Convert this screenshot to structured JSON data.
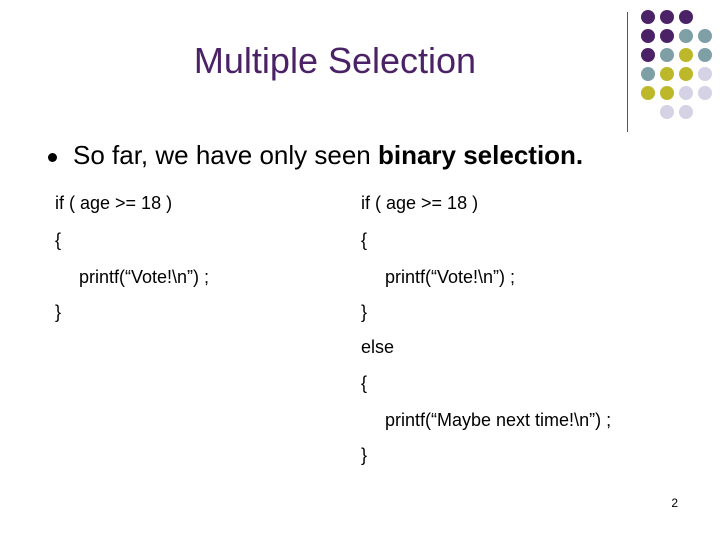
{
  "slide": {
    "title": "Multiple Selection",
    "bullet": {
      "text_before": "So far, we have only seen ",
      "text_bold": "binary selection.",
      "text_after": ""
    },
    "left_code": [
      "if ( age >= 18 )",
      "{",
      "printf(“Vote!\\n”) ;",
      "}"
    ],
    "right_code": [
      "if ( age >= 18 )",
      "{",
      "printf(“Vote!\\n”) ;",
      "}",
      "else",
      "{",
      "printf(“Maybe next time!\\n”) ;",
      "}"
    ],
    "page_number": "2"
  },
  "theme": {
    "title_color": "#4b2266",
    "purple": "#4b2266",
    "teal": "#7f9fa6",
    "olive": "#bcb82a",
    "lavender": "#d4d2e4"
  },
  "decoration": {
    "dot_grid": [
      [
        "purple",
        "purple",
        "purple",
        ""
      ],
      [
        "purple",
        "purple",
        "teal",
        "teal"
      ],
      [
        "purple",
        "teal",
        "olive",
        "teal"
      ],
      [
        "teal",
        "olive",
        "olive",
        "lavender"
      ],
      [
        "olive",
        "olive",
        "lavender",
        "lavender"
      ],
      [
        "",
        "lavender",
        "lavender",
        ""
      ]
    ]
  }
}
